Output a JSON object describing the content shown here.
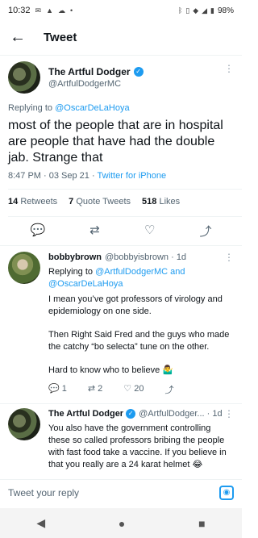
{
  "status_bar": {
    "time": "10:32",
    "battery": "98%"
  },
  "header": {
    "title": "Tweet"
  },
  "main_tweet": {
    "name": "The Artful Dodger",
    "handle": "@ArtfulDodgerMC",
    "replying_label": "Replying to ",
    "replying_to": "@OscarDeLaHoya",
    "text": "most of the people that are in hospital are people that have had the double jab. Strange that",
    "time": "8:47 PM · 03 Sep 21 · ",
    "client": "Twitter for iPhone",
    "retweets": "14",
    "retweets_label": "Retweets",
    "quote_tweets": "7",
    "quote_tweets_label": "Quote Tweets",
    "likes": "518",
    "likes_label": "Likes"
  },
  "reply1": {
    "name": "bobbybrown",
    "handle": "@bobbyisbrown · 1d",
    "replying_label": "Replying to ",
    "replying_to": "@ArtfulDodgerMC and @OscarDeLaHoya",
    "p1": "I mean you’ve got professors of virology and epidemiology on one side.",
    "p2": "Then Right Said Fred and the guys who made the catchy “bo selecta” tune on the other.",
    "p3": "Hard to know who to believe 🤷‍♂️",
    "replies": "1",
    "retweets": "2",
    "likes": "20"
  },
  "reply2": {
    "name": "The Artful Dodger",
    "handle": "@ArtfulDodger... · 1d",
    "text": "You also have the government controlling these so called professors bribing the people with fast food take a vaccine. If you believe in that you really are a 24 karat helmet 😂"
  },
  "compose": {
    "placeholder": "Tweet your reply"
  },
  "colors": {
    "accent": "#1d9bf0",
    "text": "#0f1419",
    "secondary": "#536471"
  }
}
